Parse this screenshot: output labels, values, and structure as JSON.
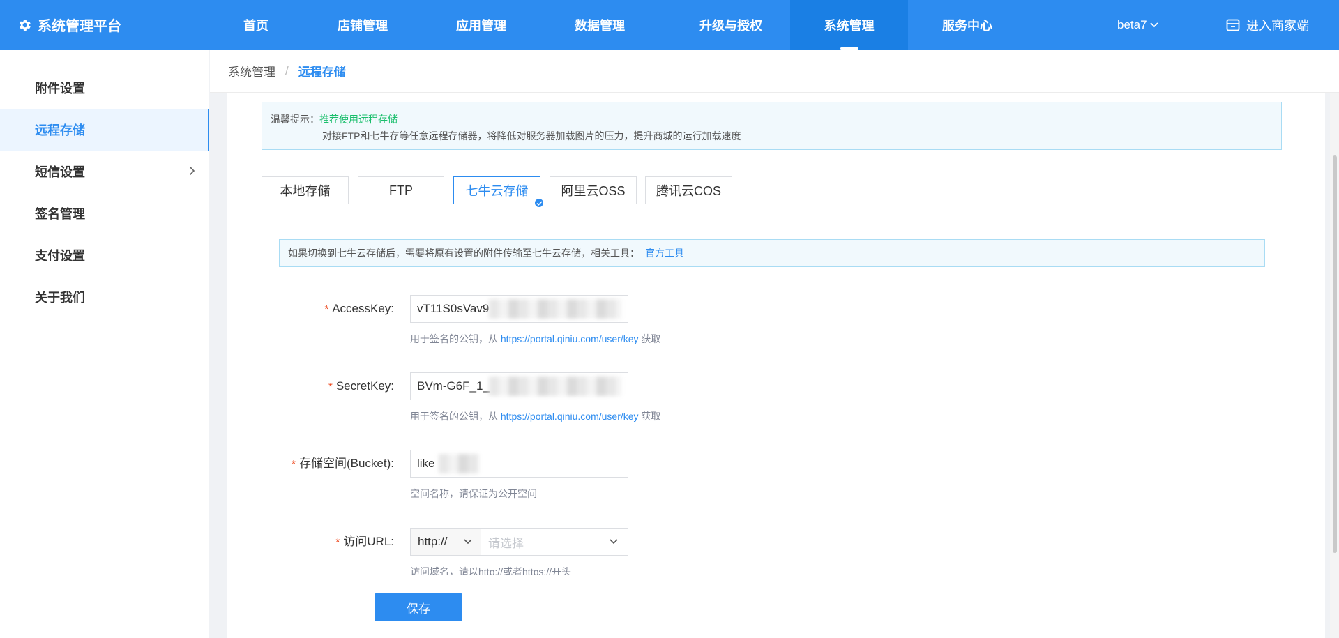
{
  "brand": {
    "title": "系统管理平台",
    "icon": "gear-icon"
  },
  "nav": {
    "items": [
      {
        "label": "首页"
      },
      {
        "label": "店铺管理"
      },
      {
        "label": "应用管理"
      },
      {
        "label": "数据管理"
      },
      {
        "label": "升级与授权"
      },
      {
        "label": "系统管理",
        "active": true
      },
      {
        "label": "服务中心"
      }
    ],
    "user": "beta7",
    "merchant_link": "进入商家端"
  },
  "sidebar": {
    "items": [
      {
        "label": "附件设置"
      },
      {
        "label": "远程存储",
        "active": true
      },
      {
        "label": "短信设置",
        "has_children": true
      },
      {
        "label": "签名管理"
      },
      {
        "label": "支付设置"
      },
      {
        "label": "关于我们"
      }
    ]
  },
  "breadcrumb": {
    "parent": "系统管理",
    "separator": "/",
    "current": "远程存储"
  },
  "tip": {
    "prefix": "温馨提示：",
    "highlight": "推荐使用远程存储",
    "description": "对接FTP和七牛存等任意远程存储器，将降低对服务器加载图片的压力，提升商城的运行加载速度"
  },
  "storage_tabs": [
    {
      "label": "本地存储"
    },
    {
      "label": "FTP"
    },
    {
      "label": "七牛云存储",
      "active": true
    },
    {
      "label": "阿里云OSS"
    },
    {
      "label": "腾讯云COS"
    }
  ],
  "notice": {
    "text": "如果切换到七牛云存储后，需要将原有设置的附件传输至七牛云存储，相关工具：",
    "link": "官方工具"
  },
  "form": {
    "access_key": {
      "label": "AccessKey:",
      "value": "vT11S0sVav9",
      "hint_prefix": "用于签名的公钥，从 ",
      "hint_link": "https://portal.qiniu.com/user/key",
      "hint_suffix": " 获取"
    },
    "secret_key": {
      "label": "SecretKey:",
      "value": "BVm-G6F_1_",
      "hint_prefix": "用于签名的公钥，从 ",
      "hint_link": "https://portal.qiniu.com/user/key",
      "hint_suffix": " 获取"
    },
    "bucket": {
      "label": "存储空间(Bucket):",
      "value": "like",
      "hint": "空间名称，请保证为公开空间"
    },
    "url": {
      "label": "访问URL:",
      "protocol": "http://",
      "placeholder": "请选择",
      "hint": "访问域名，请以http://或者https://开头"
    }
  },
  "save_label": "保存",
  "colors": {
    "primary": "#2d8cf0",
    "required": "#ed4014",
    "success": "#19be6b"
  }
}
